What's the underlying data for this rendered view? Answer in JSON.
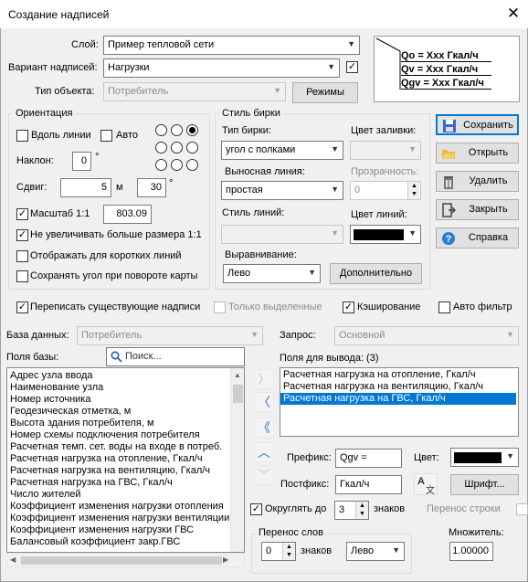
{
  "window": {
    "title": "Создание надписей"
  },
  "header": {
    "layer_label": "Слой:",
    "layer_value": "Пример тепловой сети",
    "variant_label": "Вариант надписей:",
    "variant_value": "Нагрузки",
    "object_type_label": "Тип объекта:",
    "object_type_value": "Потребитель",
    "modes_button": "Режимы",
    "preview_lines": [
      "Qo = Xxx Гкал/ч",
      "Qv = Xxx Гкал/ч",
      "Qgv = Xxx Гкал/ч"
    ]
  },
  "orientation": {
    "title": "Ориентация",
    "along_line": "Вдоль линии",
    "auto": "Авто",
    "tilt_label": "Наклон:",
    "tilt_value": "0",
    "degree": "°",
    "shift_label": "Сдвиг:",
    "shift_m": "5",
    "m_unit": "м",
    "shift_deg": "30",
    "scale_label": "Масштаб 1:1",
    "scale_value": "803.09",
    "no_enlarge": "Не увеличивать больше размера 1:1",
    "show_short": "Отображать для коротких линий",
    "keep_angle": "Сохранять угол при повороте карты"
  },
  "tag_style": {
    "title": "Стиль бирки",
    "tag_type_label": "Тип бирки:",
    "tag_type_value": "угол с полками",
    "fill_color_label": "Цвет заливки:",
    "leader_label": "Выносная линия:",
    "leader_value": "простая",
    "transparency_label": "Прозрачность:",
    "transparency_value": "0",
    "line_style_label": "Стиль линий:",
    "line_color_label": "Цвет линий:",
    "align_label": "Выравнивание:",
    "align_value": "Лево",
    "more_button": "Дополнительно"
  },
  "actions": {
    "save": "Сохранить",
    "open": "Открыть",
    "delete": "Удалить",
    "close": "Закрыть",
    "help": "Справка"
  },
  "options": {
    "overwrite": "Переписать существующие надписи",
    "only_selected": "Только выделенные",
    "caching": "Кэширование",
    "auto_filter": "Авто фильтр"
  },
  "database": {
    "db_label": "База данных:",
    "db_value": "Потребитель",
    "query_label": "Запрос:",
    "query_value": "Основной",
    "fields_label": "Поля базы:",
    "search_placeholder": "Поиск...",
    "fields": [
      "Адрес узла ввода",
      "Наименование узла",
      "Номер источника",
      "Геодезическая отметка, м",
      "Высота здания потребителя, м",
      "Номер схемы подключения потребителя",
      "Расчетная темп. сет. воды на входе в потреб.",
      "Расчетная нагрузка на отопление, Гкал/ч",
      "Расчетная нагрузка на вентиляцию, Гкал/ч",
      "Расчетная нагрузка на ГВС, Гкал/ч",
      "Число жителей",
      "Коэффициент изменения нагрузки отопления",
      "Коэффициент изменения нагрузки вентиляции",
      "Коэффициент изменения нагрузки ГВС",
      "Балансовый коэффициент закр.ГВС"
    ],
    "output_label": "Поля для вывода: (3)",
    "output_fields": [
      "Расчетная нагрузка на отопление, Гкал/ч",
      "Расчетная нагрузка на вентиляцию, Гкал/ч",
      "Расчетная нагрузка на ГВС, Гкал/ч"
    ]
  },
  "format": {
    "prefix_label": "Префикс:",
    "prefix_value": "Qgv =",
    "color_label": "Цвет:",
    "postfix_label": "Постфикс:",
    "postfix_value": "Гкал/ч",
    "font_button": "Шрифт...",
    "round_label": "Округлять до",
    "round_value": "3",
    "digits_label": "знаков",
    "wrap_line": "Перенос строки",
    "word_wrap_title": "Перенос слов",
    "wrap_value": "0",
    "wrap_unit": "знаков",
    "wrap_align": "Лево",
    "multiplier_label": "Множитель:",
    "multiplier_value": "1.00000"
  },
  "colors": {
    "accent": "#0078d7",
    "link_blue": "#2a6fd6",
    "swatch": "#000000"
  }
}
